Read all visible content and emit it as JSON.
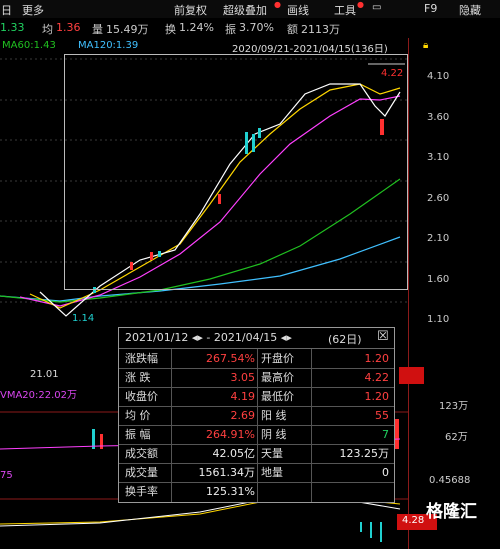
{
  "toolbar": {
    "left_label": "日",
    "more": "更多",
    "restore_adj": "前复权",
    "super_overlay": "超级叠加",
    "draw_line": "画线",
    "tools": "工具",
    "f9": "F9",
    "hide": "隐藏"
  },
  "quote": {
    "price": "1.33",
    "avg_label": "均",
    "avg_value": "1.36",
    "vol_label": "量",
    "vol_value": "15.49万",
    "turnover_label": "换",
    "turnover_value": "1.24%",
    "amplitude_label": "振",
    "amplitude_value": "3.70%",
    "amount_label": "额",
    "amount_value": "2113万"
  },
  "ma": {
    "ma60": "MA60:1.43",
    "ma120": "MA120:1.39",
    "date_range": "2020/09/21-2021/04/15(136日)"
  },
  "y_axis": {
    "ticks": [
      "4.10",
      "3.60",
      "3.10",
      "2.60",
      "2.10",
      "1.60",
      "1.10"
    ],
    "vol_ticks": [
      "123万",
      "62万"
    ],
    "macd_tick": "0.45688",
    "current_price_tag": "4.28"
  },
  "chart_labels": {
    "high_marker": "4.22",
    "low_marker": "1.14",
    "x_date": "21.01",
    "vma": "VMA20:22.02万",
    "left_cut": "75"
  },
  "popup": {
    "range": "2021/01/12 ◂▸ - 2021/04/15 ◂▸",
    "days": "(62日)",
    "close_glyph": "☒",
    "rows": [
      {
        "l1": "涨跌幅",
        "v1": "267.54%",
        "c1": "red",
        "l2": "开盘价",
        "v2": "1.20",
        "c2": "red"
      },
      {
        "l1": "涨 跌",
        "v1": "3.05",
        "c1": "red",
        "l2": "最高价",
        "v2": "4.22",
        "c2": "red"
      },
      {
        "l1": "收盘价",
        "v1": "4.19",
        "c1": "red",
        "l2": "最低价",
        "v2": "1.20",
        "c2": "red"
      },
      {
        "l1": "均 价",
        "v1": "2.69",
        "c1": "red",
        "l2": "阳 线",
        "v2": "55",
        "c2": "red"
      },
      {
        "l1": "振 幅",
        "v1": "264.91%",
        "c1": "red",
        "l2": "阴 线",
        "v2": "7",
        "c2": "grn"
      },
      {
        "l1": "成交额",
        "v1": "42.05亿",
        "c1": "wht",
        "l2": "天量",
        "v2": "123.25万",
        "c2": "wht"
      },
      {
        "l1": "成交量",
        "v1": "1561.34万",
        "c1": "wht",
        "l2": "地量",
        "v2": "0",
        "c2": "wht"
      },
      {
        "l1": "换手率",
        "v1": "125.31%",
        "c1": "wht",
        "l2": "",
        "v2": "",
        "c2": "wht"
      }
    ]
  },
  "watermark": "格隆汇",
  "colors": {
    "up": "#ff3030",
    "down": "#20d0d0",
    "ma5": "#ffffff",
    "ma10": "#ffd700",
    "ma20": "#ff40ff",
    "ma60": "#20c020",
    "ma120": "#40c0ff",
    "axis_border": "#8b1a1a"
  }
}
